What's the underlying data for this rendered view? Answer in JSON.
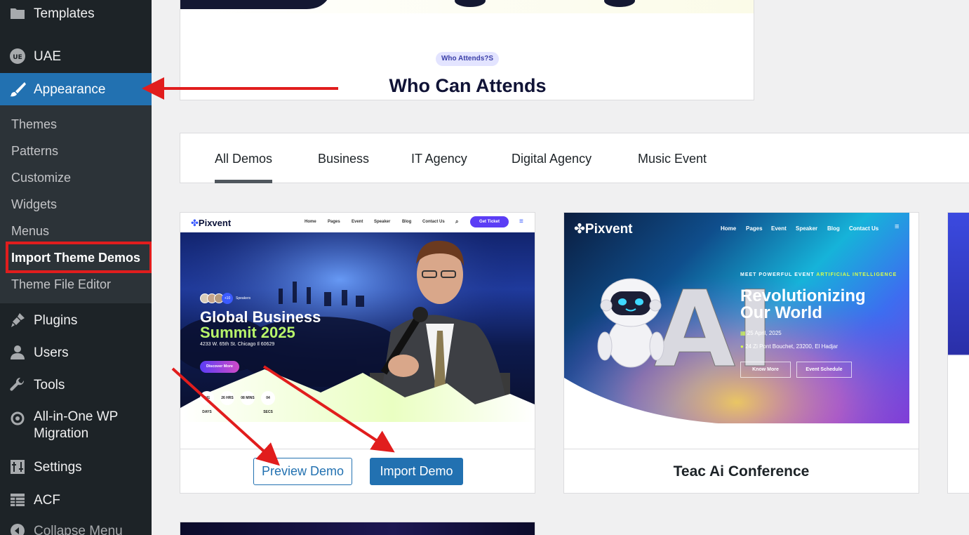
{
  "sidebar": {
    "items": [
      {
        "icon": "folder-icon",
        "label": "Templates"
      },
      {
        "icon": "uae-icon",
        "label": "UAE"
      },
      {
        "icon": "paintbrush-icon",
        "label": "Appearance"
      },
      {
        "icon": "plugin-icon",
        "label": "Plugins"
      },
      {
        "icon": "users-icon",
        "label": "Users"
      },
      {
        "icon": "wrench-icon",
        "label": "Tools"
      },
      {
        "icon": "migration-icon",
        "label": "All-in-One WP Migration"
      },
      {
        "icon": "settings-icon",
        "label": "Settings"
      },
      {
        "icon": "acf-icon",
        "label": "ACF"
      },
      {
        "icon": "collapse-icon",
        "label": "Collapse Menu"
      }
    ],
    "appearance_submenu": [
      "Themes",
      "Patterns",
      "Customize",
      "Widgets",
      "Menus",
      "Import Theme Demos",
      "Theme File Editor"
    ]
  },
  "top_preview": {
    "badge": "Who Attends?S",
    "heading": "Who Can Attends"
  },
  "tabs": [
    "All Demos",
    "Business",
    "IT Agency",
    "Digital Agency",
    "Music Event"
  ],
  "demo1": {
    "logo": "Pixvent",
    "nav": [
      "Home",
      "Pages",
      "Event",
      "Speaker",
      "Blog",
      "Contact Us"
    ],
    "ticket": "Get Ticket",
    "speakers": "+10",
    "speakers_label": "Speakers",
    "title_line1": "Global Business",
    "title_line2": "Summit 2025",
    "address": "4233 W. 65th St. Chicago Il 60629",
    "discover": "Discover More",
    "countdown": [
      "341 DAYS",
      "26 HRS",
      "08 MINS",
      "04 SECS"
    ],
    "preview_button": "Preview Demo",
    "import_button": "Import Demo"
  },
  "demo2": {
    "logo": "Pixvent",
    "nav": [
      "Home",
      "Pages",
      "Event",
      "Speaker",
      "Blog",
      "Contact Us"
    ],
    "tag_prefix": "MEET POWERFUL EVENT",
    "tag_highlight": "ARTIFICIAL INTELLIGENCE",
    "title_line1": "Revolutionizing",
    "title_line2": "Our World",
    "date": "25 April, 2025",
    "location": "24 Zi Pont Bouchet, 23200,  El Hadjar",
    "btn1": "Know More",
    "btn2": "Event Schedule",
    "card_title": "Teac Ai Conference"
  },
  "colors": {
    "accent": "#2271b1",
    "sidebar": "#1d2327",
    "annotation": "#e11d1d"
  }
}
